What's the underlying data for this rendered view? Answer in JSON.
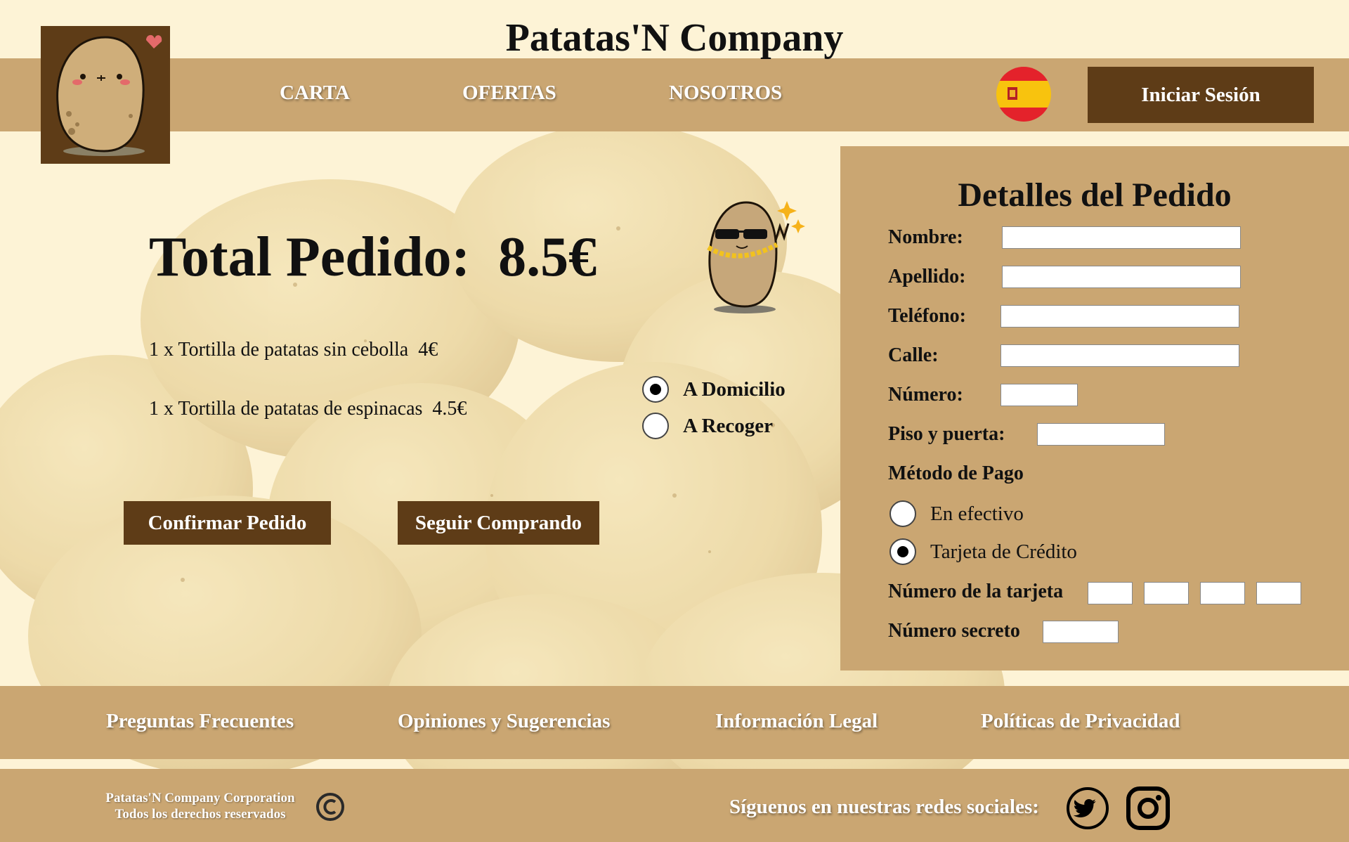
{
  "header": {
    "title": "Patatas'N Company",
    "nav": [
      "CARTA",
      "OFERTAS",
      "NOSOTROS"
    ],
    "login_label": "Iniciar Sesión",
    "language_icon": "spain-flag-icon"
  },
  "order": {
    "total_label": "Total Pedido:  8.5€",
    "items": [
      "1 x Tortilla de patatas sin cebolla  4€",
      "1 x Tortilla de patatas de espinacas  4.5€"
    ],
    "delivery_options": [
      {
        "label": "A Domicilio",
        "selected": true
      },
      {
        "label": "A Recoger",
        "selected": false
      }
    ],
    "confirm_label": "Confirmar Pedido",
    "continue_label": "Seguir Comprando"
  },
  "details": {
    "title": "Detalles del Pedido",
    "fields": {
      "nombre": "Nombre:",
      "apellido": "Apellido:",
      "telefono": "Teléfono:",
      "calle": "Calle:",
      "numero": "Número:",
      "piso": "Piso y puerta:"
    },
    "payment_title": "Método de Pago",
    "payment_options": [
      {
        "label": "En efectivo",
        "selected": false
      },
      {
        "label": "Tarjeta de Crédito",
        "selected": true
      }
    ],
    "card_number_label": "Número de la tarjeta",
    "secret_label": "Número secreto"
  },
  "footer": {
    "links": [
      "Preguntas Frecuentes",
      "Opiniones y Sugerencias",
      "Información Legal",
      "Políticas de Privacidad"
    ],
    "corp_line1": "Patatas'N Company Corporation",
    "corp_line2": "Todos los derechos reservados",
    "social_label": "Síguenos en nuestras redes sociales:",
    "social_icons": [
      "twitter-icon",
      "instagram-icon"
    ]
  },
  "colors": {
    "background": "#fdf3d6",
    "bar": "#caa672",
    "dark_brown": "#5e3c17"
  }
}
